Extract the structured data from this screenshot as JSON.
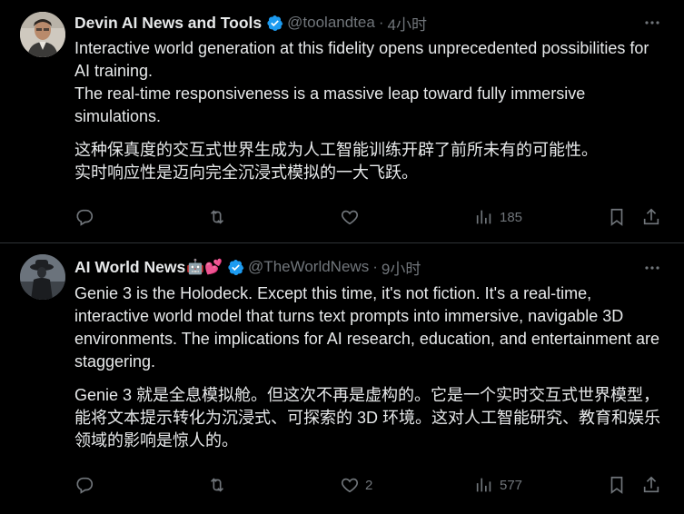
{
  "tweets": [
    {
      "author_name": "Devin AI News and Tools",
      "handle": "@toolandtea",
      "separator": "·",
      "time": "4小时",
      "text_en_1": "Interactive world generation at this fidelity opens unprecedented possibilities for AI training.",
      "text_en_2": "The real-time responsiveness is a massive leap toward fully immersive simulations.",
      "text_zh_1": "这种保真度的交互式世界生成为人工智能训练开辟了前所未有的可能性。",
      "text_zh_2": "实时响应性是迈向完全沉浸式模拟的一大飞跃。",
      "replies": "",
      "retweets": "",
      "likes": "",
      "views": "185"
    },
    {
      "author_name": "AI World News",
      "name_emojis": "🤖💕",
      "handle": "@TheWorldNews",
      "separator": "·",
      "time": "9小时",
      "text_en": "Genie 3 is the Holodeck. Except this time, it's not fiction. It's a real-time, interactive world model that turns text prompts into immersive, navigable 3D environments. The implications for AI research, education, and entertainment are staggering.",
      "text_zh": "Genie 3 就是全息模拟舱。但这次不再是虚构的。它是一个实时交互式世界模型，能将文本提示转化为沉浸式、可探索的 3D 环境。这对人工智能研究、教育和娱乐领域的影响是惊人的。",
      "replies": "",
      "retweets": "",
      "likes": "2",
      "views": "577"
    }
  ],
  "colors": {
    "background": "#000000",
    "text": "#e7e9ea",
    "secondary": "#71767b",
    "verified": "#1d9bf0",
    "divider": "#2f3336"
  },
  "icons": [
    "reply-icon",
    "retweet-icon",
    "like-icon",
    "views-icon",
    "bookmark-icon",
    "share-icon",
    "more-icon",
    "verified-icon"
  ]
}
